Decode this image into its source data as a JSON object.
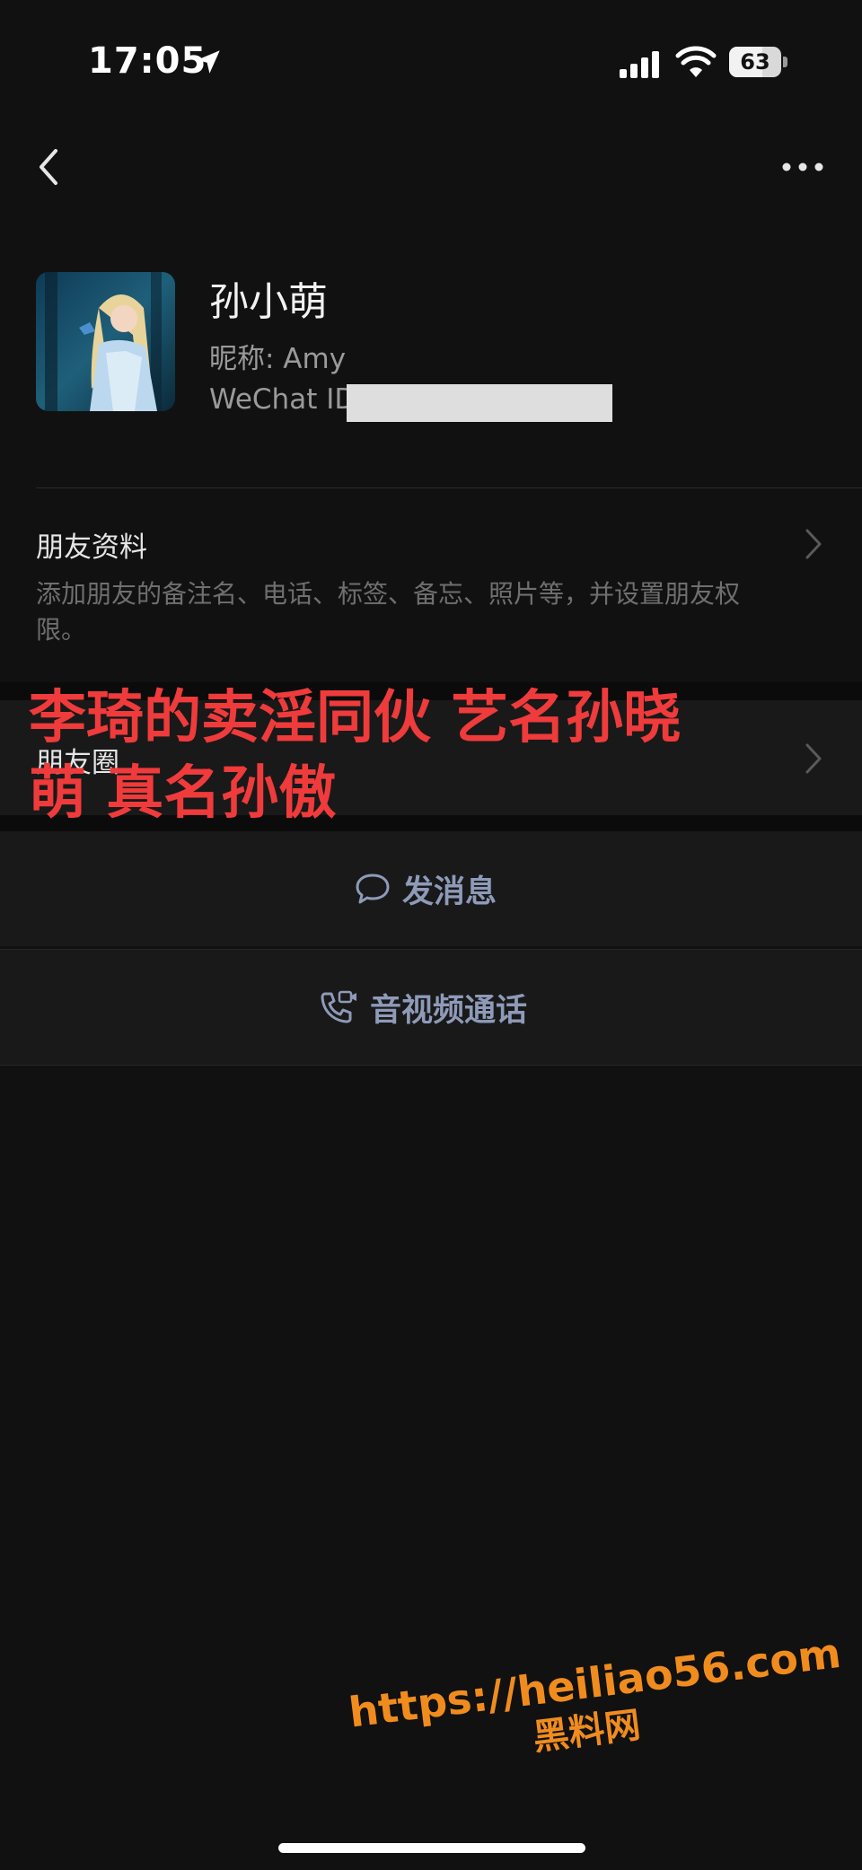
{
  "status_bar": {
    "time": "17:05",
    "battery_level": "63",
    "battery_fraction": 0.63
  },
  "nav": {
    "back_icon": "chevron-left-icon",
    "more_icon": "more-dots-icon"
  },
  "profile": {
    "name": "孙小萌",
    "nickname": "昵称: Amy",
    "wechat_id_label": "WeChat ID"
  },
  "friend_info": {
    "title": "朋友资料",
    "description": "添加朋友的备注名、电话、标签、备忘、照片等，并设置朋友权限。"
  },
  "moments": {
    "title": "朋友圈"
  },
  "actions": {
    "message_label": "发消息",
    "call_label": "音视频通话"
  },
  "overlay_text": {
    "line1": "李琦的卖淫同伙 艺名孙晓",
    "line2": "萌 真名孙傲"
  },
  "watermark": {
    "url": "https://heiliao56.com",
    "name": "黑料网"
  },
  "colors": {
    "accent_link": "#8e9ab8",
    "overlay_red": "#ef3b3b",
    "watermark_orange": "#f08c1e"
  }
}
